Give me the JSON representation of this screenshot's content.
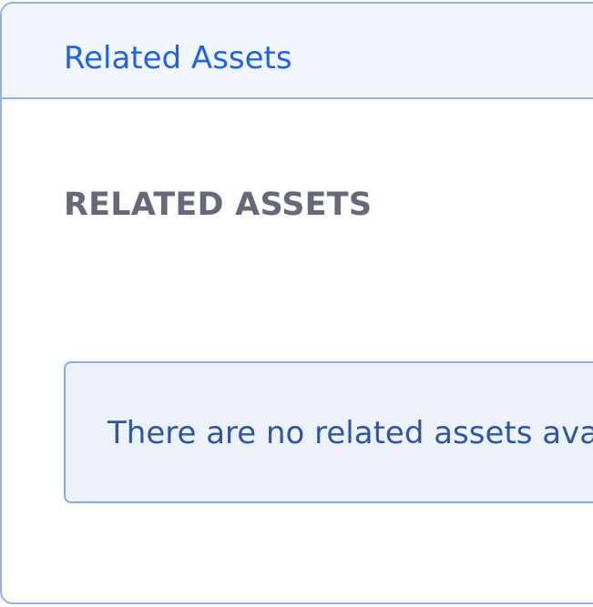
{
  "panel": {
    "header_title": "Related Assets"
  },
  "section": {
    "title": "RELATED ASSETS"
  },
  "empty_state": {
    "message": "There are no related assets available"
  },
  "colors": {
    "header_title": "#1f63e8",
    "header_background": "#f0f5fe",
    "border": "#8fb1ef",
    "section_title": "#656a7a",
    "alert_background": "#edf2fa",
    "alert_text": "#2d56a6"
  }
}
